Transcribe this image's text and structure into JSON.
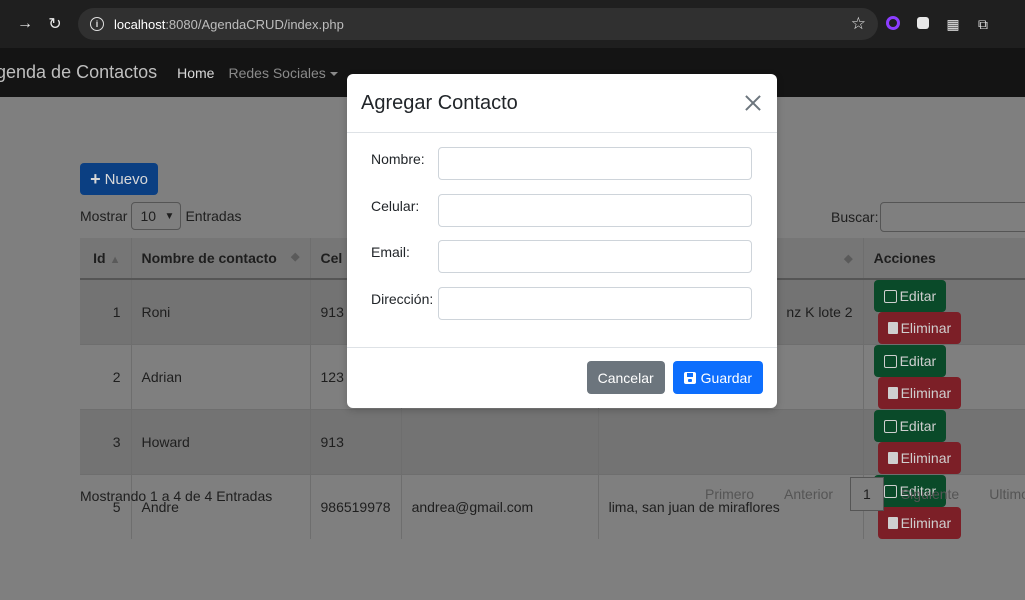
{
  "browser": {
    "url_host": "localhost",
    "url_path": ":8080/AgendaCRUD/index.php"
  },
  "navbar": {
    "brand": "genda de Contactos",
    "links": [
      {
        "label": "Home"
      },
      {
        "label": "Redes Sociales"
      }
    ]
  },
  "toolbar": {
    "new_label": "Nuevo",
    "show_label": "Mostrar",
    "page_length": "10",
    "entries_label": "Entradas",
    "search_label": "Buscar:"
  },
  "table": {
    "headers": [
      "Id",
      "Nombre de contacto",
      "Cel",
      "",
      "",
      "Acciones"
    ],
    "rows": [
      {
        "id": "1",
        "name": "Roni",
        "cel": "913",
        "email": "",
        "address": "nz K lote 2"
      },
      {
        "id": "2",
        "name": "Adrian",
        "cel": "123",
        "email": "",
        "address": ""
      },
      {
        "id": "3",
        "name": "Howard",
        "cel": "913",
        "email": "",
        "address": ""
      },
      {
        "id": "5",
        "name": "Andre",
        "cel": "986519978",
        "email": "andrea@gmail.com",
        "address": "lima, san juan de miraflores"
      }
    ],
    "edit_label": "Editar",
    "delete_label": "Eliminar"
  },
  "footer": {
    "info": "Mostrando 1 a 4 de 4 Entradas",
    "first": "Primero",
    "previous": "Anterior",
    "current_page": "1",
    "next": "Siguiente",
    "last": "Ultimo"
  },
  "modal": {
    "title": "Agregar Contacto",
    "fields": [
      {
        "label": "Nombre:",
        "value": ""
      },
      {
        "label": "Celular:",
        "value": ""
      },
      {
        "label": "Email:",
        "value": ""
      },
      {
        "label": "Dirección:",
        "value": ""
      }
    ],
    "cancel_label": "Cancelar",
    "save_label": "Guardar"
  }
}
